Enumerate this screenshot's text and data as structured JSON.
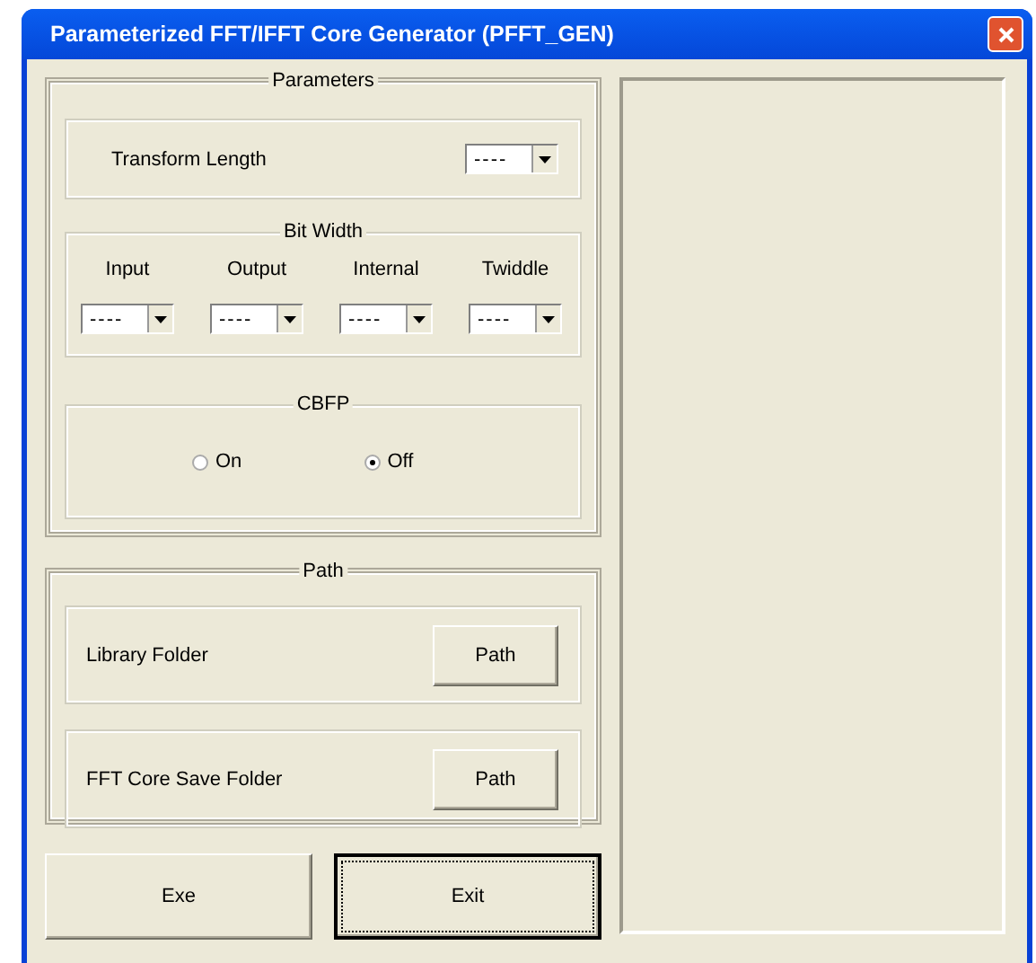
{
  "window": {
    "title": "Parameterized FFT/IFFT Core Generator (PFFT_GEN)"
  },
  "parameters": {
    "title": "Parameters",
    "transform_length": {
      "label": "Transform Length",
      "value": "----"
    },
    "bit_width": {
      "title": "Bit Width",
      "fields": [
        {
          "label": "Input",
          "value": "----"
        },
        {
          "label": "Output",
          "value": "----"
        },
        {
          "label": "Internal",
          "value": "----"
        },
        {
          "label": "Twiddle",
          "value": "----"
        }
      ]
    },
    "cbfp": {
      "title": "CBFP",
      "options": [
        {
          "label": "On",
          "selected": false
        },
        {
          "label": "Off",
          "selected": true
        }
      ]
    }
  },
  "path": {
    "title": "Path",
    "rows": [
      {
        "label": "Library Folder",
        "button": "Path"
      },
      {
        "label": "FFT Core Save Folder",
        "button": "Path"
      }
    ]
  },
  "buttons": [
    {
      "label": "Exe",
      "focused": false
    },
    {
      "label": "Exit",
      "focused": true
    }
  ]
}
